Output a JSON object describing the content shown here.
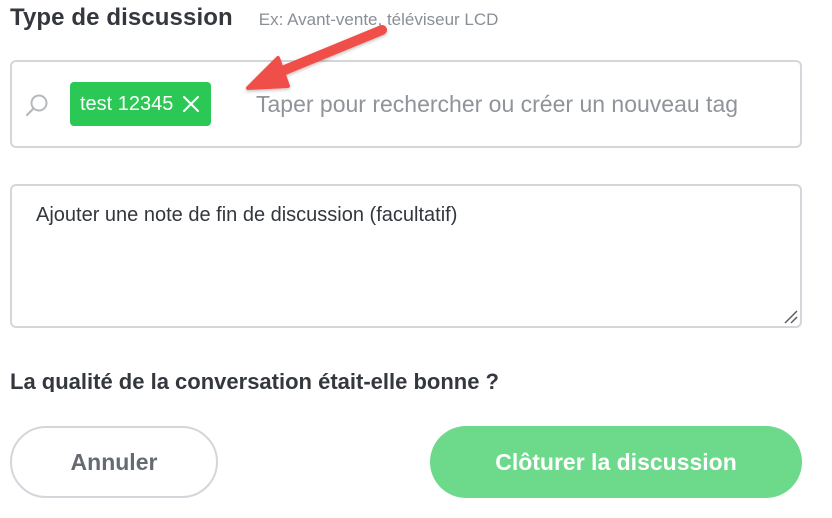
{
  "section": {
    "title": "Type de discussion",
    "hint": "Ex: Avant-vente, téléviseur LCD"
  },
  "tag_input": {
    "icon": "search-icon",
    "tags": [
      {
        "label": "test 12345",
        "remove_icon": "close-icon"
      }
    ],
    "placeholder": "Taper pour rechercher ou créer un nouveau tag",
    "value": ""
  },
  "note": {
    "placeholder": "Ajouter une note de fin de discussion (facultatif)",
    "value": ""
  },
  "quality": {
    "question": "La qualité de la conversation était-elle bonne ?"
  },
  "actions": {
    "cancel_label": "Annuler",
    "close_label": "Clôturer la discussion"
  },
  "annotation": {
    "icon": "arrow-icon",
    "color": "#f0504a"
  },
  "colors": {
    "tag_bg": "#2bc855",
    "primary_button": "#6cd98b",
    "border": "#d3d6da"
  }
}
